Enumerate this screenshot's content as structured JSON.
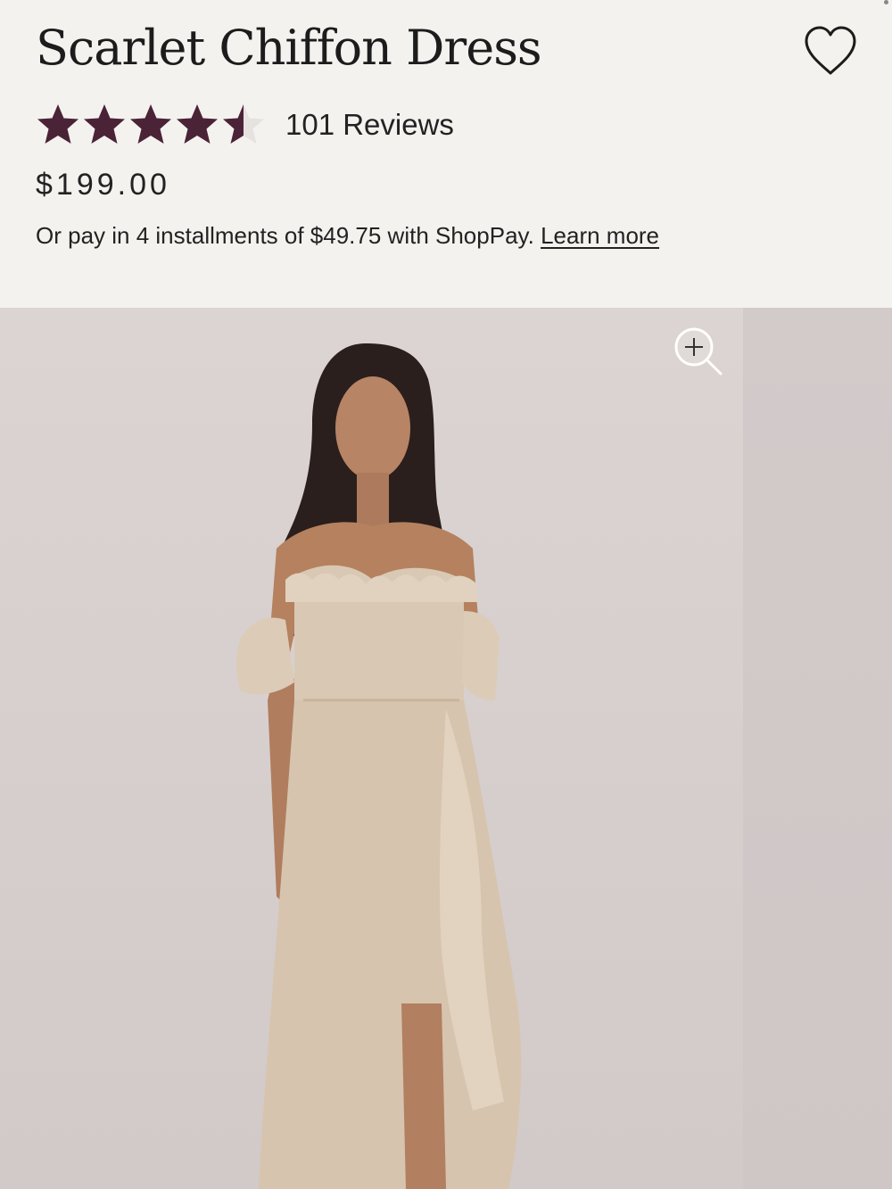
{
  "product": {
    "title": "Scarlet Chiffon Dress",
    "rating": 4.5,
    "rating_max": 5,
    "reviews_label": "101 Reviews",
    "price": "$199.00",
    "installments_text": "Or pay in 4 installments of $49.75 with ShopPay.",
    "learn_more_label": "Learn more"
  },
  "icons": {
    "wishlist": "heart-outline-icon",
    "star": "star-icon",
    "zoom": "zoom-in-icon"
  },
  "colors": {
    "star_fill": "#4a2337",
    "star_empty": "#e6e2e0",
    "background": "#f4f2ef",
    "photo_background": "#d8d0ce",
    "dress": "#d9c8b4"
  }
}
